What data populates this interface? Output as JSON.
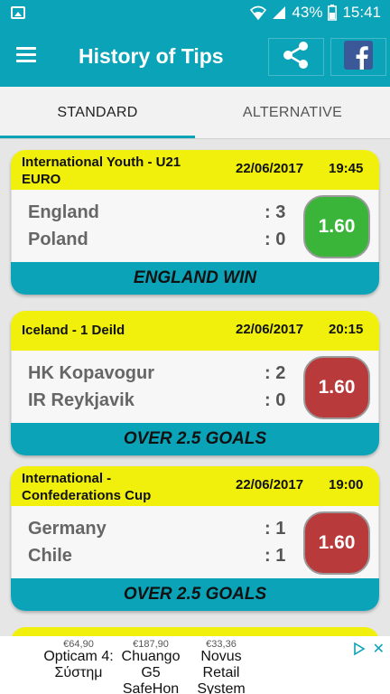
{
  "status_bar": {
    "battery": "43%",
    "time": "15:41"
  },
  "app_bar": {
    "title": "History of Tips"
  },
  "tabs": [
    {
      "label": "STANDARD",
      "active": true
    },
    {
      "label": "ALTERNATIVE",
      "active": false
    }
  ],
  "tips": [
    {
      "league": "International Youth - U21 EURO",
      "date": "22/06/2017",
      "time": "19:45",
      "home": "England",
      "home_score": ": 3",
      "away": "Poland",
      "away_score": ": 0",
      "odds": "1.60",
      "result": "win",
      "tip": "ENGLAND WIN"
    },
    {
      "league": "Iceland - 1 Deild",
      "date": "22/06/2017",
      "time": "20:15",
      "home": "HK Kopavogur",
      "home_score": ": 2",
      "away": "IR Reykjavik",
      "away_score": ": 0",
      "odds": "1.60",
      "result": "loss",
      "tip": "OVER 2.5 GOALS"
    },
    {
      "league": "International - Confederations Cup",
      "date": "22/06/2017",
      "time": "19:00",
      "home": "Germany",
      "home_score": ": 1",
      "away": "Chile",
      "away_score": ": 1",
      "odds": "1.60",
      "result": "loss",
      "tip": "OVER 2.5 GOALS"
    }
  ],
  "ad": {
    "items": [
      {
        "price": "€64,90",
        "name": "Opticam 4: Σύστημ"
      },
      {
        "price": "€187,90",
        "name": "Chuango G5 SafeHon"
      },
      {
        "price": "€33,36",
        "name": "Novus Retail System"
      }
    ]
  },
  "colors": {
    "accent": "#0aa3b8",
    "header_yellow": "#f0f00c",
    "win_green": "#3ab53a",
    "loss_red": "#b83a3a"
  }
}
